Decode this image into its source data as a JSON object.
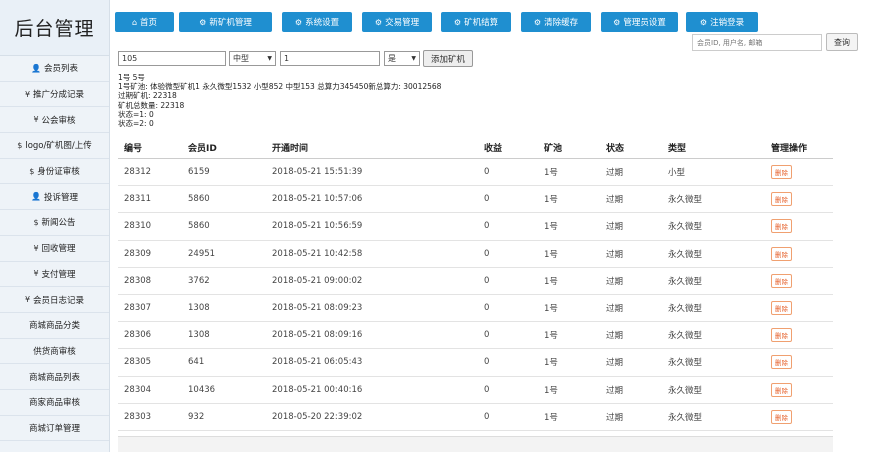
{
  "sidebar": {
    "logo": "后台管理",
    "items": [
      {
        "icon": "user-icon",
        "glyph": "👤",
        "label": "会员列表"
      },
      {
        "icon": "yen-icon",
        "glyph": "¥",
        "label": "推广分成记录"
      },
      {
        "icon": "yen-icon",
        "glyph": "¥",
        "label": "公会审核"
      },
      {
        "icon": "dollar-icon",
        "glyph": "$",
        "label": "logo/矿机图/上传"
      },
      {
        "icon": "dollar-icon",
        "glyph": "$",
        "label": "身份证审核"
      },
      {
        "icon": "user-icon",
        "glyph": "👤",
        "label": "投诉管理"
      },
      {
        "icon": "dollar-icon",
        "glyph": "$",
        "label": "新闻公告"
      },
      {
        "icon": "yen-icon",
        "glyph": "¥",
        "label": "回收管理"
      },
      {
        "icon": "yen-icon",
        "glyph": "¥",
        "label": "支付管理"
      },
      {
        "icon": "yen-icon",
        "glyph": "¥",
        "label": "会员日志记录"
      },
      {
        "icon": "",
        "glyph": "",
        "label": "商城商品分类"
      },
      {
        "icon": "",
        "glyph": "",
        "label": "供货商审核"
      },
      {
        "icon": "",
        "glyph": "",
        "label": "商城商品列表"
      },
      {
        "icon": "",
        "glyph": "",
        "label": "商家商品审核"
      },
      {
        "icon": "",
        "glyph": "",
        "label": "商城订单管理"
      }
    ]
  },
  "topnav": {
    "tabs": [
      {
        "icon": "home-icon",
        "glyph": "⌂",
        "label": "首页"
      },
      {
        "icon": "cogs-icon",
        "glyph": "⚙",
        "label": "新矿机管理"
      },
      {
        "icon": "cogs-icon",
        "glyph": "⚙",
        "label": "系统设置"
      },
      {
        "icon": "cogs-icon",
        "glyph": "⚙",
        "label": "交易管理"
      },
      {
        "icon": "cogs-icon",
        "glyph": "⚙",
        "label": "矿机结算"
      },
      {
        "icon": "cogs-icon",
        "glyph": "⚙",
        "label": "清除缓存"
      },
      {
        "icon": "cogs-icon",
        "glyph": "⚙",
        "label": "管理员设置"
      },
      {
        "icon": "cogs-icon",
        "glyph": "⚙",
        "label": "注销登录"
      }
    ]
  },
  "search": {
    "placeholder": "会员ID, 用户名, 邮箱",
    "button": "查询"
  },
  "form": {
    "number_value": "105",
    "type_select": "中型",
    "count_value": "1",
    "flag_select": "是",
    "add_button": "添加矿机"
  },
  "info": {
    "lines": [
      "1号 5号",
      "1号矿池: 体验微型矿机1 永久微型1532 小型852 中型153 总算力345450新总算力: 30012568",
      "过期矿机: 22318",
      "矿机总数量: 22318",
      "状态=1: 0",
      "状态=2: 0"
    ]
  },
  "table": {
    "headers": [
      "编号",
      "会员ID",
      "开通时间",
      "收益",
      "矿池",
      "状态",
      "类型",
      "管理操作"
    ],
    "delete_label": "删除",
    "rows": [
      [
        "28312",
        "6159",
        "2018-05-21 15:51:39",
        "0",
        "1号",
        "过期",
        "小型"
      ],
      [
        "28311",
        "5860",
        "2018-05-21 10:57:06",
        "0",
        "1号",
        "过期",
        "永久微型"
      ],
      [
        "28310",
        "5860",
        "2018-05-21 10:56:59",
        "0",
        "1号",
        "过期",
        "永久微型"
      ],
      [
        "28309",
        "24951",
        "2018-05-21 10:42:58",
        "0",
        "1号",
        "过期",
        "永久微型"
      ],
      [
        "28308",
        "3762",
        "2018-05-21 09:00:02",
        "0",
        "1号",
        "过期",
        "永久微型"
      ],
      [
        "28307",
        "1308",
        "2018-05-21 08:09:23",
        "0",
        "1号",
        "过期",
        "永久微型"
      ],
      [
        "28306",
        "1308",
        "2018-05-21 08:09:16",
        "0",
        "1号",
        "过期",
        "永久微型"
      ],
      [
        "28305",
        "641",
        "2018-05-21 06:05:43",
        "0",
        "1号",
        "过期",
        "永久微型"
      ],
      [
        "28304",
        "10436",
        "2018-05-21 00:40:16",
        "0",
        "1号",
        "过期",
        "永久微型"
      ],
      [
        "28303",
        "932",
        "2018-05-20 22:39:02",
        "0",
        "1号",
        "过期",
        "永久微型"
      ]
    ]
  },
  "colors": {
    "tab_bg": "#1f8fd0",
    "sidebar_bg": "#eef3f8",
    "delete_accent": "#e6602a"
  }
}
